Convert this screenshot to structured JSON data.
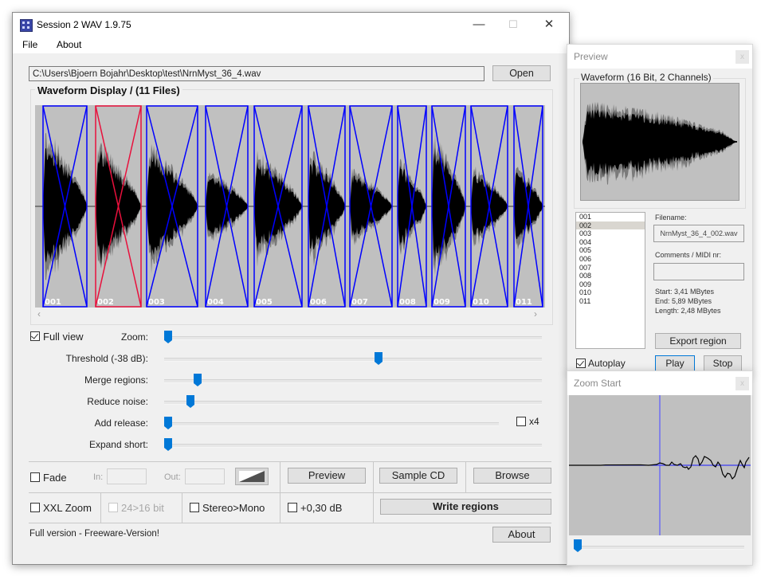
{
  "main_window": {
    "title": "Session 2 WAV 1.9.75",
    "window_controls": {
      "minimize": "—",
      "maximize": "☐",
      "close": "✕"
    },
    "menu": [
      "File",
      "About"
    ],
    "path_value": "C:\\Users\\Bjoern Bojahr\\Desktop\\test\\NrnMyst_36_4.wav",
    "open_label": "Open",
    "waveform_title": "Waveform Display / (11 Files)",
    "regions": [
      {
        "label": "001",
        "selected": false
      },
      {
        "label": "002",
        "selected": true
      },
      {
        "label": "003",
        "selected": false
      },
      {
        "label": "004",
        "selected": false
      },
      {
        "label": "005",
        "selected": false
      },
      {
        "label": "006",
        "selected": false
      },
      {
        "label": "007",
        "selected": false
      },
      {
        "label": "008",
        "selected": false
      },
      {
        "label": "009",
        "selected": false
      },
      {
        "label": "010",
        "selected": false
      },
      {
        "label": "011",
        "selected": false
      }
    ],
    "region_color": "#0000ff",
    "selected_region_color": "#e8103c",
    "scroll_left_icon": "‹",
    "scroll_right_icon": "›",
    "full_view": {
      "label": "Full view",
      "checked": true
    },
    "sliders": [
      {
        "label": "Zoom:",
        "value": 0.0
      },
      {
        "label": "Threshold (-38 dB):",
        "value": 0.57
      },
      {
        "label": "Merge regions:",
        "value": 0.08
      },
      {
        "label": "Reduce noise:",
        "value": 0.06
      },
      {
        "label": "Add release:",
        "value": 0.0
      },
      {
        "label": "Expand short:",
        "value": 0.0
      }
    ],
    "x4": {
      "label": "x4",
      "checked": false
    },
    "fade": {
      "label": "Fade",
      "checked": false,
      "in_label": "In:",
      "out_label": "Out:",
      "in_value": "",
      "out_value": ""
    },
    "preview_label": "Preview",
    "sample_cd_label": "Sample CD",
    "browse_label": "Browse",
    "xxl_zoom": {
      "label": "XXL Zoom",
      "checked": false
    },
    "bit_convert": {
      "label": "24>16 bit",
      "checked": false,
      "disabled": true
    },
    "stereo_mono": {
      "label": "Stereo>Mono",
      "checked": false
    },
    "gain": {
      "label": "+0,30 dB",
      "checked": false
    },
    "write_regions_label": "Write regions",
    "status": "Full version -  Freeware-Version!",
    "about_label": "About"
  },
  "preview_window": {
    "title": "Preview",
    "close": "x",
    "waveform_title": "Waveform (16 Bit, 2 Channels)",
    "list": [
      "001",
      "002",
      "003",
      "004",
      "005",
      "006",
      "007",
      "008",
      "009",
      "010",
      "011"
    ],
    "selected_index": 1,
    "filename_label": "Filename:",
    "filename_value": "NrnMyst_36_4_002.wav",
    "comments_label": "Comments / MIDI nr:",
    "comments_value": "",
    "start": "Start: 3,41 MBytes",
    "end": "End: 5,89 MBytes",
    "length": "Length: 2,48 MBytes",
    "export_label": "Export region",
    "autoplay": {
      "label": "Autoplay",
      "checked": true
    },
    "play_label": "Play",
    "stop_label": "Stop"
  },
  "zoom_window": {
    "title": "Zoom Start",
    "close": "x",
    "slider_value": 0.0
  }
}
